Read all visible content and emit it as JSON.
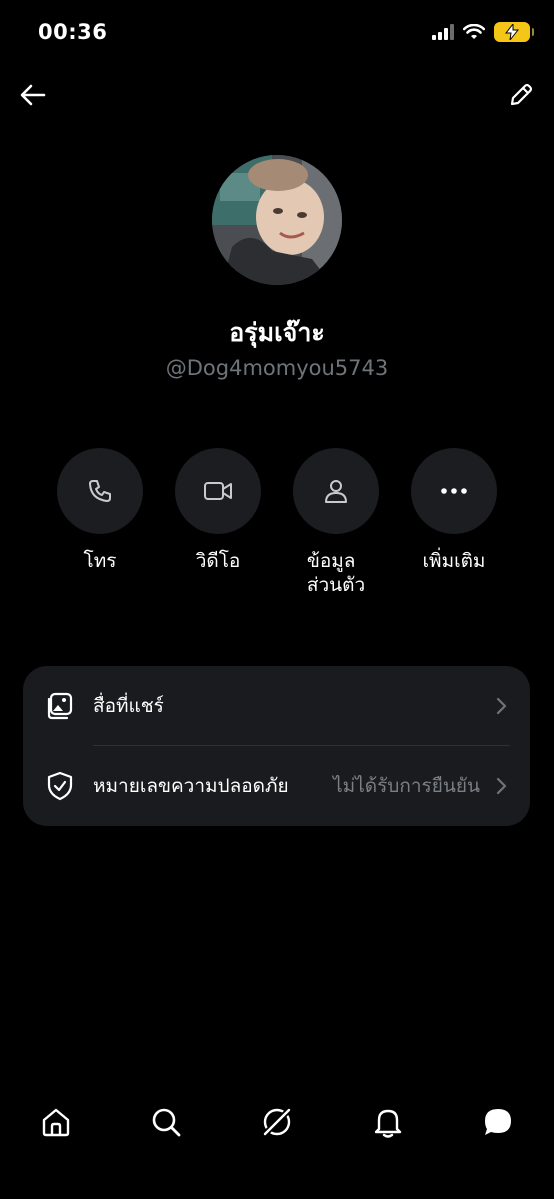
{
  "status_bar": {
    "time": "00:36"
  },
  "profile": {
    "display_name": "อรุ่มเจ๊าะ",
    "handle": "@Dog4momyou5743"
  },
  "actions": [
    {
      "label": "โทร",
      "icon": "phone-icon"
    },
    {
      "label": "วิดีโอ",
      "icon": "video-icon"
    },
    {
      "label": "ข้อมูล\nส่วนตัว",
      "icon": "person-icon"
    },
    {
      "label": "เพิ่มเติม",
      "icon": "more-icon"
    }
  ],
  "card": {
    "shared_media_label": "สื่อที่แชร์",
    "safety_number_label": "หมายเลขความปลอดภัย",
    "safety_number_value": "ไม่ได้รับการยืนยัน"
  },
  "bottom_nav": [
    "home-icon",
    "search-icon",
    "grok-icon",
    "notifications-icon",
    "messages-icon"
  ],
  "colors": {
    "background": "#000000",
    "surface": "#1a1b1e",
    "muted_text": "#6f7479",
    "battery": "#f5c518"
  }
}
